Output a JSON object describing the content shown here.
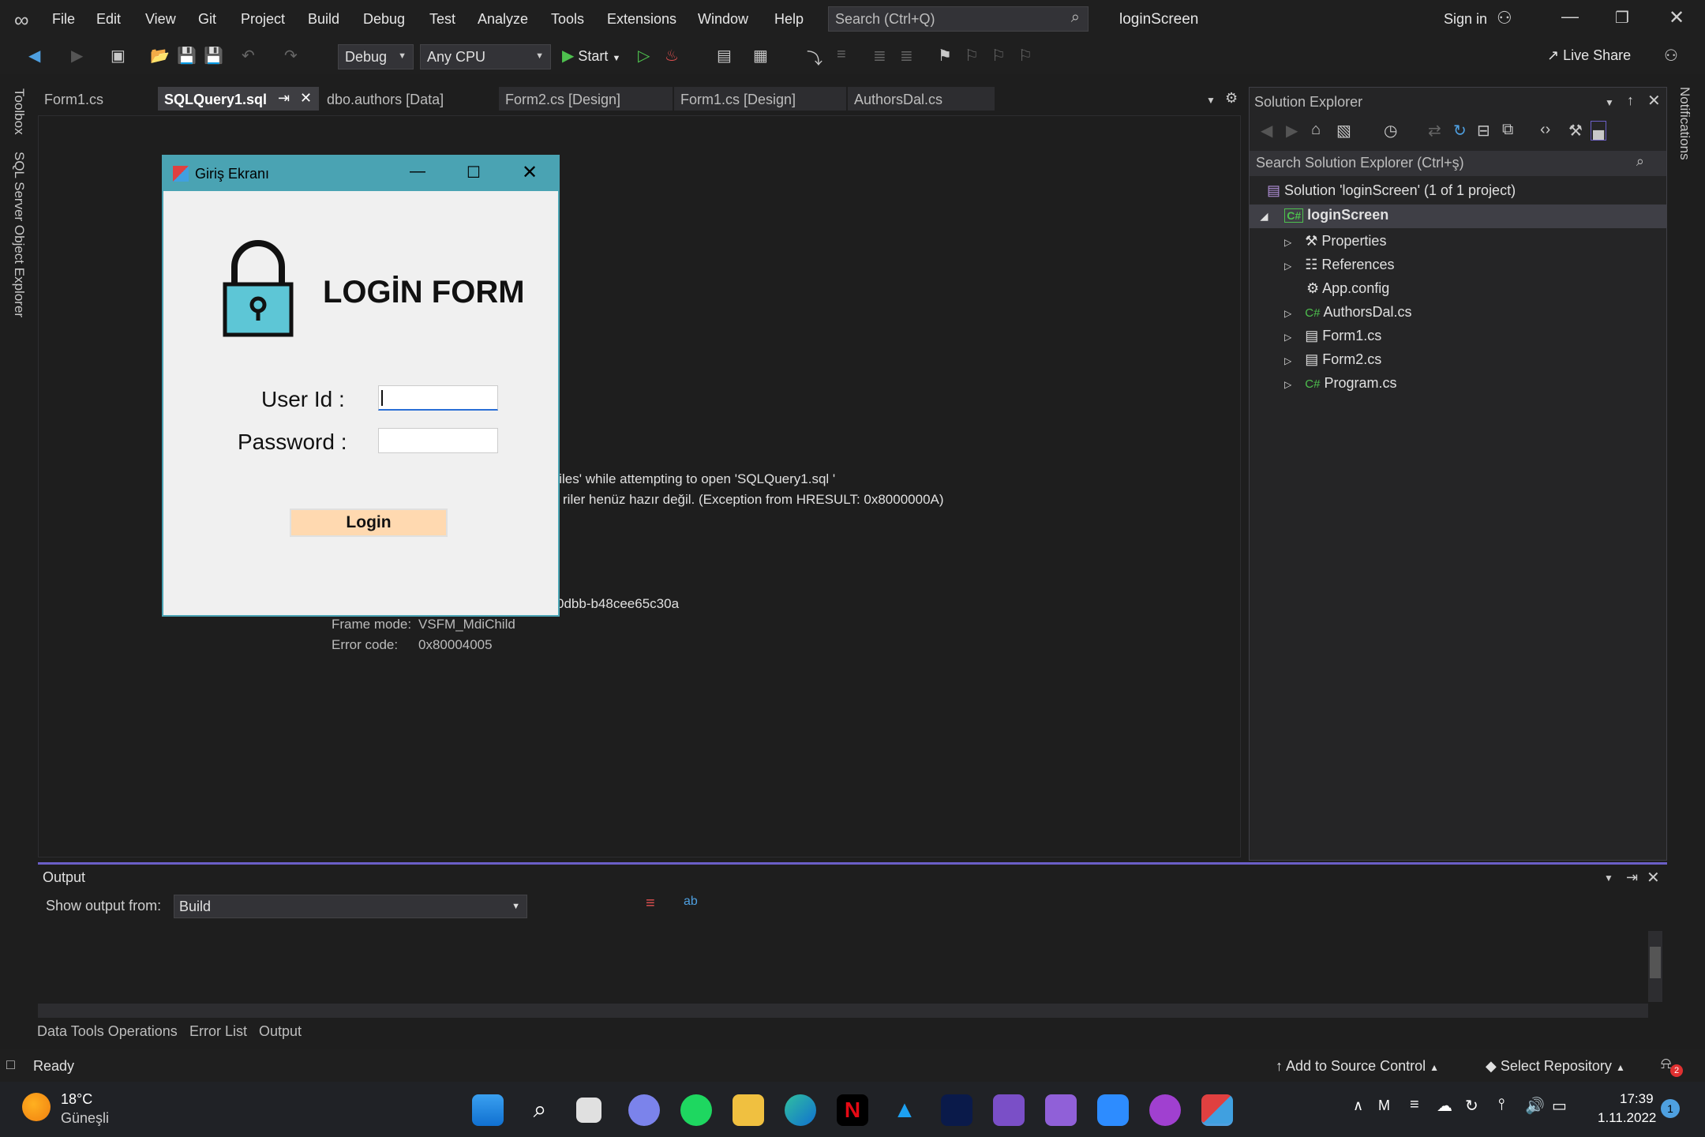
{
  "app": {
    "title": "loginScreen",
    "sign_in": "Sign in",
    "live_share": "Live Share",
    "search_placeholder": "Search (Ctrl+Q)"
  },
  "menu": [
    "File",
    "Edit",
    "View",
    "Git",
    "Project",
    "Build",
    "Debug",
    "Test",
    "Analyze",
    "Tools",
    "Extensions",
    "Window",
    "Help"
  ],
  "toolbar": {
    "config": "Debug",
    "platform": "Any CPU",
    "start": "Start"
  },
  "tabs": [
    "Form1.cs",
    "SQLQuery1.sql",
    "dbo.authors [Data]",
    "Form2.cs [Design]",
    "Form1.cs [Design]",
    "AuthorsDal.cs"
  ],
  "error": {
    "line1": "'iles' while attempting to open 'SQLQuery1.sql '",
    "line2": "riler henüz hazır değil. (Exception from HRESULT: 0x8000000A)",
    "line3": "0dbb-b48cee65c30a",
    "frame_label": "Frame mode:",
    "frame_value": "VSFM_MdiChild",
    "code_label": "Error code:",
    "code_value": "0x80004005"
  },
  "dialog": {
    "title": "Giriş Ekranı",
    "heading": "LOGİN FORM",
    "user_label": "User Id :",
    "pass_label": "Password :",
    "login_button": "Login",
    "user_value": "",
    "pass_value": ""
  },
  "side": {
    "toolbox": "Toolbox",
    "sql_explorer": "SQL Server Object Explorer",
    "notifications": "Notifications"
  },
  "solution_explorer": {
    "title": "Solution Explorer",
    "search_placeholder": "Search Solution Explorer (Ctrl+ş)",
    "solution": "Solution 'loginScreen' (1 of 1 project)",
    "project": "loginScreen",
    "items": [
      "Properties",
      "References",
      "App.config",
      "AuthorsDal.cs",
      "Form1.cs",
      "Form2.cs",
      "Program.cs"
    ]
  },
  "output": {
    "title": "Output",
    "show_from": "Show output from:",
    "source": "Build"
  },
  "bottom_tabs": [
    "Data Tools Operations",
    "Error List",
    "Output"
  ],
  "status": {
    "ready": "Ready",
    "add_source": "Add to Source Control",
    "select_repo": "Select Repository",
    "notif_count": "2"
  },
  "taskbar": {
    "temp": "18°C",
    "weather": "Güneşli",
    "time": "17:39",
    "date": "1.11.2022",
    "badge": "1"
  }
}
